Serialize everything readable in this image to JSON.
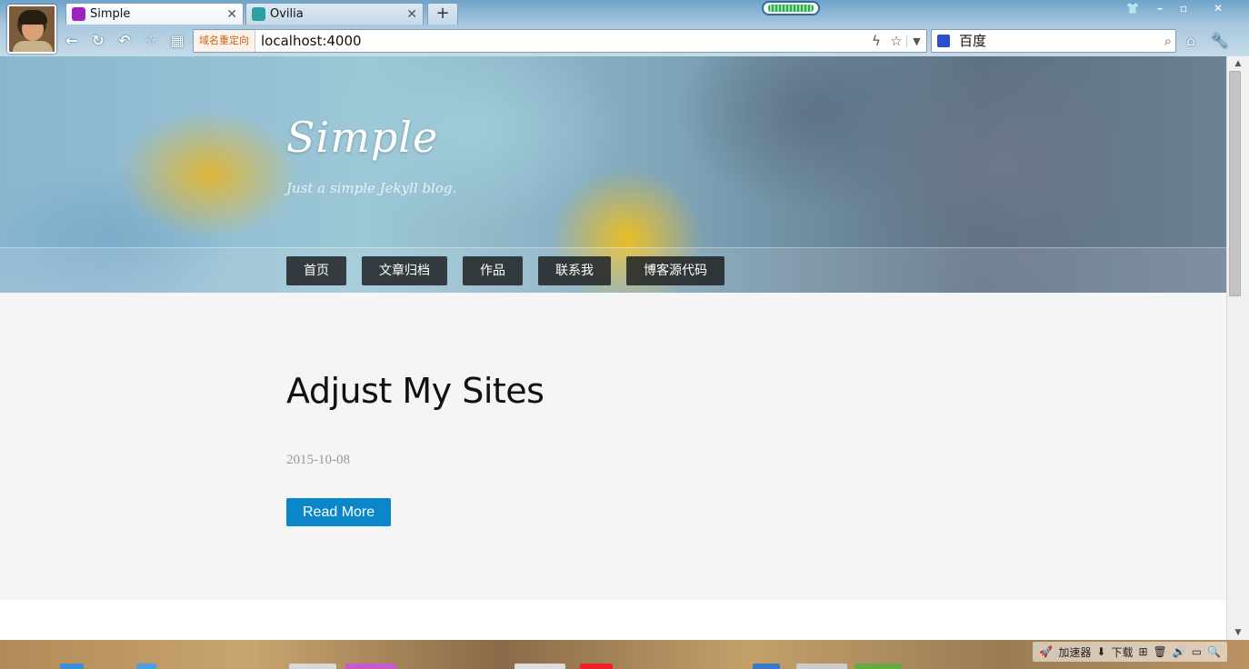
{
  "browser": {
    "tabs": [
      {
        "title": "Simple",
        "favicon_color": "#a020c0",
        "active": true
      },
      {
        "title": "Ovilia",
        "favicon_color": "#2aa0a0",
        "active": false
      }
    ],
    "new_tab_label": "+",
    "redirect_label": "域名重定向",
    "url": "localhost:4000",
    "search_engine": "百度",
    "window_buttons": {
      "skin": "👕",
      "minimize": "–",
      "restore": "▫",
      "close": "✕"
    }
  },
  "page": {
    "site_title": "Simple",
    "site_subtitle": "Just a simple Jekyll blog.",
    "nav": [
      "首页",
      "文章归档",
      "作品",
      "联系我",
      "博客源代码"
    ],
    "post": {
      "title": "Adjust My Sites",
      "date": "2015-10-08",
      "read_more": "Read More"
    }
  },
  "taskbar": {
    "tray": [
      "加速器",
      "下载"
    ]
  },
  "colors": {
    "accent_button": "#0b86c8",
    "nav_button_bg": "#1e2224",
    "content_bg": "#f5f5f5"
  }
}
